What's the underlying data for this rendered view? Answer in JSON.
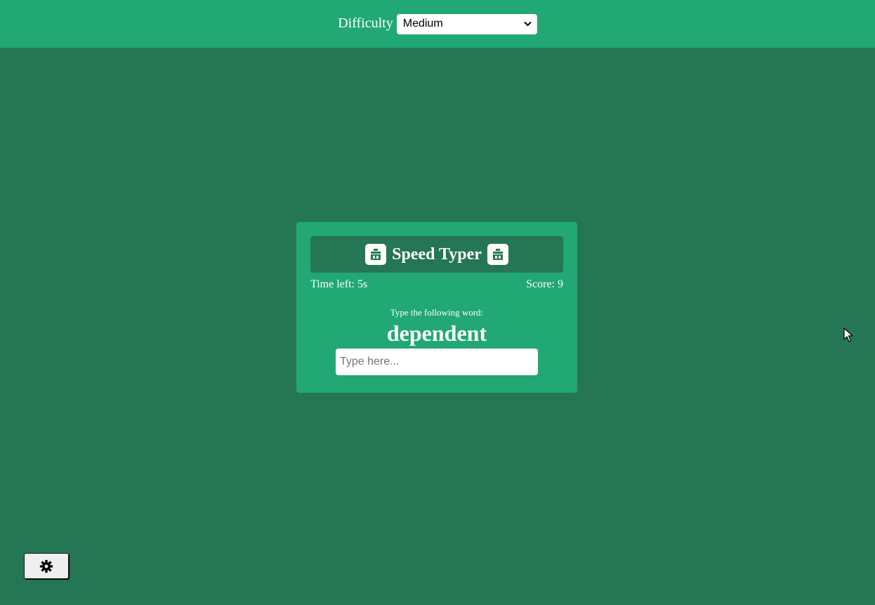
{
  "header": {
    "difficulty_label": "Difficulty",
    "difficulty_selected": "Medium"
  },
  "game": {
    "title": "Speed Typer",
    "time_left": "Time left: 5s",
    "score": "Score: 9",
    "prompt": "Type the following word:",
    "word": "dependent",
    "input_placeholder": "Type here...",
    "input_value": ""
  },
  "icons": {
    "title_left": "typewriter-icon",
    "title_right": "typewriter-icon",
    "settings": "gear-icon",
    "select_arrow": "chevron-down-icon"
  },
  "colors": {
    "background": "#257654",
    "accent": "#21a874"
  }
}
